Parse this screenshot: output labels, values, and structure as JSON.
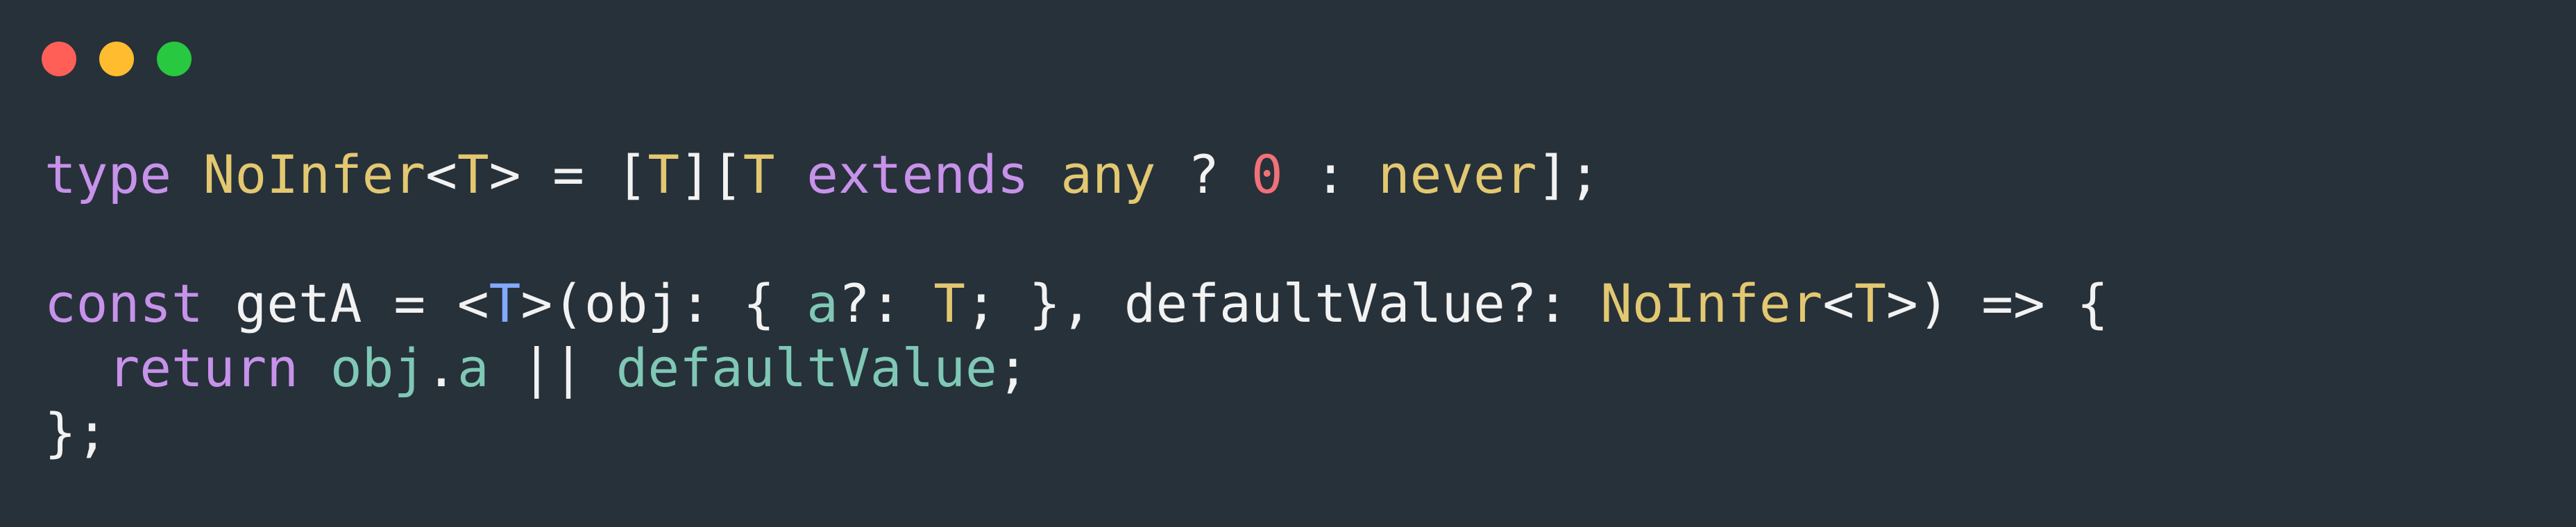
{
  "window": {
    "controls": {
      "close_color": "#ff5f57",
      "minimize_color": "#febc2e",
      "maximize_color": "#28c840"
    }
  },
  "code": {
    "lines": [
      [
        {
          "text": "type",
          "kind": "keyword"
        },
        {
          "text": " ",
          "kind": "plain"
        },
        {
          "text": "NoInfer",
          "kind": "type"
        },
        {
          "text": "<",
          "kind": "plain"
        },
        {
          "text": "T",
          "kind": "type"
        },
        {
          "text": "> = [",
          "kind": "plain"
        },
        {
          "text": "T",
          "kind": "type"
        },
        {
          "text": "][",
          "kind": "plain"
        },
        {
          "text": "T",
          "kind": "type"
        },
        {
          "text": " ",
          "kind": "plain"
        },
        {
          "text": "extends",
          "kind": "keyword"
        },
        {
          "text": " ",
          "kind": "plain"
        },
        {
          "text": "any",
          "kind": "type"
        },
        {
          "text": " ? ",
          "kind": "plain"
        },
        {
          "text": "0",
          "kind": "num"
        },
        {
          "text": " : ",
          "kind": "plain"
        },
        {
          "text": "never",
          "kind": "type"
        },
        {
          "text": "];",
          "kind": "plain"
        }
      ],
      [],
      [
        {
          "text": "const",
          "kind": "keyword"
        },
        {
          "text": " getA = <",
          "kind": "plain"
        },
        {
          "text": "T",
          "kind": "generic"
        },
        {
          "text": ">(obj: { ",
          "kind": "plain"
        },
        {
          "text": "a",
          "kind": "prop"
        },
        {
          "text": "?: ",
          "kind": "plain"
        },
        {
          "text": "T",
          "kind": "type"
        },
        {
          "text": "; }, defaultValue?: ",
          "kind": "plain"
        },
        {
          "text": "NoInfer",
          "kind": "type"
        },
        {
          "text": "<",
          "kind": "plain"
        },
        {
          "text": "T",
          "kind": "type"
        },
        {
          "text": ">) => {",
          "kind": "plain"
        }
      ],
      [
        {
          "text": "  ",
          "kind": "plain"
        },
        {
          "text": "return",
          "kind": "keyword"
        },
        {
          "text": " ",
          "kind": "plain"
        },
        {
          "text": "obj",
          "kind": "prop"
        },
        {
          "text": ".",
          "kind": "plain"
        },
        {
          "text": "a",
          "kind": "prop"
        },
        {
          "text": " || ",
          "kind": "plain"
        },
        {
          "text": "defaultValue",
          "kind": "prop"
        },
        {
          "text": ";",
          "kind": "plain"
        }
      ],
      [
        {
          "text": "};",
          "kind": "plain"
        }
      ]
    ]
  }
}
